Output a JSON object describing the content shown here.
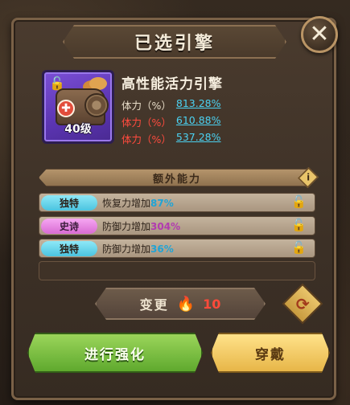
{
  "dialog": {
    "title": "已选引擎",
    "close_glyph": "✕"
  },
  "item": {
    "name": "高性能活力引擎",
    "level_text": "40级",
    "icon": "engine-icon",
    "stats": [
      {
        "label": "体力（%）",
        "value": "813.28%",
        "color": "#e7dcc8"
      },
      {
        "label": "体力（%）",
        "value": "610.88%",
        "color": "#ff4b3e"
      },
      {
        "label": "体力（%）",
        "value": "537.28%",
        "color": "#ff4b3e"
      }
    ]
  },
  "extra": {
    "header": "额外能力",
    "info_glyph": "i",
    "rows": [
      {
        "tag": "独特",
        "tag_color": "#4bc4e0",
        "desc": "恢复力增加",
        "pct": "87%"
      },
      {
        "tag": "史诗",
        "tag_color": "#d86bd2",
        "desc": "防御力增加",
        "pct": "304%"
      },
      {
        "tag": "独特",
        "tag_color": "#4bc4e0",
        "desc": "防御力增加",
        "pct": "36%"
      }
    ]
  },
  "change": {
    "label": "变更",
    "cost": "10",
    "currency_icon": "flame-icon"
  },
  "actions": {
    "upgrade": "进行强化",
    "equip": "穿戴"
  }
}
